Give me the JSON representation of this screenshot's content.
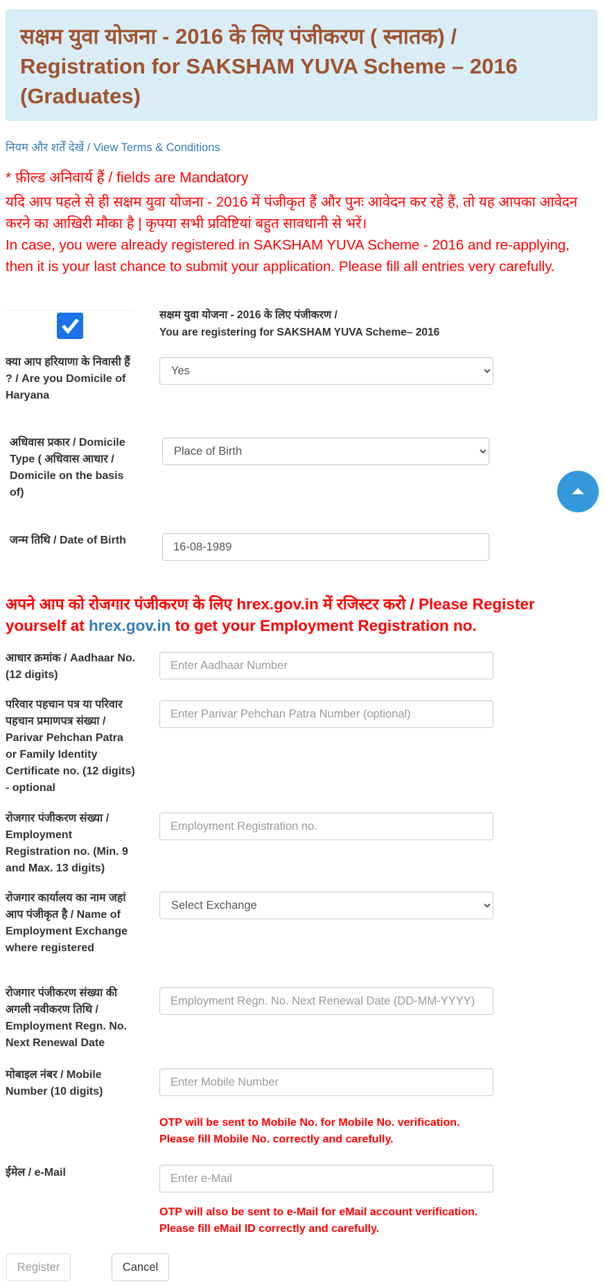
{
  "header": {
    "title": "सक्षम युवा योजना - 2016 के लिए पंजीकरण ( स्नातक) / Registration for SAKSHAM YUVA Scheme – 2016 (Graduates)"
  },
  "terms": {
    "hindi": "नियम और शर्तें देखें",
    "sep": " / ",
    "english": "View Terms & Conditions"
  },
  "mandatory": "* फ़ील्ड अनिवार्य हैं / fields are Mandatory",
  "warning": {
    "hindi": "यदि आप पहले से ही सक्षम युवा योजना - 2016 में पंजीकृत हैं और पुनः आवेदन कर रहे हैं, तो यह आपका आवेदन करने का आखिरी मौका है | कृपया सभी प्रविष्टियां बहुत सावधानी से भरें।",
    "english": "In case, you were already registered in SAKSHAM YUVA Scheme - 2016 and re-applying, then it is your last chance to submit your application. Please fill all entries very carefully."
  },
  "scheme_check": {
    "checked": true,
    "line1": "सक्षम युवा योजना - 2016 के लिए पंजीकरण /",
    "line2": "You are registering for SAKSHAM YUVA Scheme– 2016",
    "accent": "#1a73e8"
  },
  "domicile": {
    "label": "क्या आप हरियाणा के निवासी हैं ? / Are you Domicile of Haryana",
    "value": "Yes"
  },
  "domicile_type": {
    "label": "अधिवास प्रकार / Domicile Type ( अधिवास आधार / Domicile on the basis of)",
    "value": "Place of Birth"
  },
  "dob": {
    "label": "जन्म तिथि / Date of Birth",
    "value": "16-08-1989"
  },
  "register_notice": {
    "part1": "अपने आप को रोजगार पंजीकरण के लिए hrex.gov.in में रजिस्टर करो / Please Register yourself at ",
    "link": "hrex.gov.in",
    "part2": " to get your Employment Registration no."
  },
  "aadhaar": {
    "label": "आधार क्रमांक / Aadhaar No. (12 digits)",
    "placeholder": "Enter Aadhaar Number"
  },
  "parivar": {
    "label": "परिवार पहचान पत्र या परिवार पहचान प्रमाणपत्र संख्या / Parivar Pehchan Patra or Family Identity Certificate no. (12 digits) - optional",
    "placeholder": "Enter Parivar Pehchan Patra Number (optional)"
  },
  "emp_reg": {
    "label": "रोजगार पंजीकरण संख्या / Employment Registration no. (Min. 9 and Max. 13 digits)",
    "placeholder": "Employment Registration no."
  },
  "exchange": {
    "label": "रोजगार कार्यालय का नाम जहां आप पंजीकृत है / Name of Employment Exchange where registered",
    "value": "Select Exchange"
  },
  "renewal": {
    "label": "रोजगार पंजीकरण संख्या की अगली नवीकरण तिथि / Employment Regn. No. Next Renewal Date",
    "placeholder": "Employment Regn. No. Next Renewal Date (DD-MM-YYYY)"
  },
  "mobile": {
    "label": "मोबाइल नंबर / Mobile Number (10 digits)",
    "placeholder": "Enter Mobile Number",
    "note1": "OTP will be sent to Mobile No. for Mobile No. verification.",
    "note2": "Please fill Mobile No. correctly and carefully."
  },
  "email": {
    "label": "ईमेल / e-Mail",
    "placeholder": "Enter e-Mail",
    "note1": "OTP will also be sent to e-Mail for eMail account verification.",
    "note2": "Please fill eMail ID correctly and carefully."
  },
  "buttons": {
    "register": "Register",
    "cancel": "Cancel"
  },
  "scroll_top": {
    "icon": "caret-up-icon",
    "color": "#3498db"
  }
}
